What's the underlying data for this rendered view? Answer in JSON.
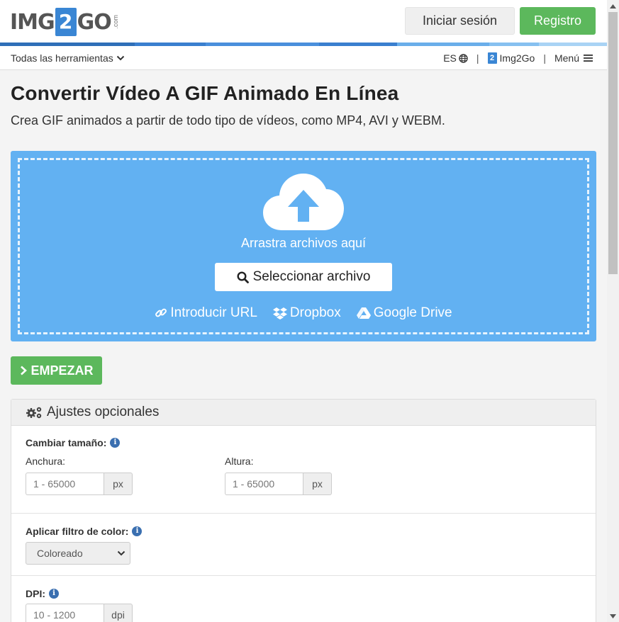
{
  "brand": {
    "img": "IMG",
    "two": "2",
    "go": "GO",
    "com": ".com"
  },
  "header": {
    "login_label": "Iniciar sesión",
    "register_label": "Registro"
  },
  "colors": {
    "accent_blue": "#3a86d4",
    "upload_bg": "#62b1f2",
    "green": "#5cb85c"
  },
  "nav": {
    "tools_label": "Todas las herramientas",
    "lang_label": "ES",
    "sep": "|",
    "img2go_label": "Img2Go",
    "img2go_icon_text": "2",
    "menu_label": "Menú"
  },
  "page": {
    "title": "Convertir Vídeo A GIF Animado En Línea",
    "subtitle": "Crea GIF animados a partir de todo tipo de vídeos, como MP4, AVI y WEBM."
  },
  "upload": {
    "drag_text": "Arrastra archivos aquí",
    "select_label": "Seleccionar archivo",
    "url_label": "Introducir URL",
    "dropbox_label": "Dropbox",
    "gdrive_label": "Google Drive"
  },
  "start_label": "EMPEZAR",
  "settings": {
    "title": "Ajustes opcionales",
    "info_glyph": "i",
    "resize_label": "Cambiar tamaño:",
    "width_label": "Anchura:",
    "width_placeholder": "1 - 65000",
    "width_unit": "px",
    "height_label": "Altura:",
    "height_placeholder": "1 - 65000",
    "height_unit": "px",
    "filter_label": "Aplicar filtro de color:",
    "filter_value": "Coloreado",
    "dpi_label": "DPI:",
    "dpi_placeholder": "10 - 1200",
    "dpi_unit": "dpi"
  }
}
